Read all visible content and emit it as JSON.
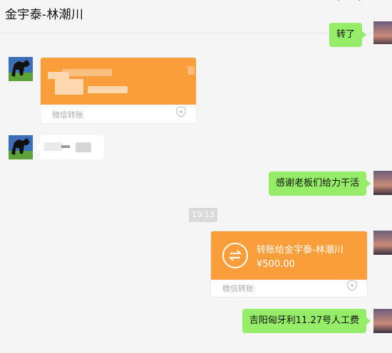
{
  "header": {
    "title": "金宇泰-林潮川"
  },
  "messages": {
    "top_partial_text": "转了",
    "left_transfer_footer": "微信转账",
    "thanks_text": "感谢老板们给力干活",
    "timestamp": "19:13",
    "transfer": {
      "recipient_text": "转账给金宇泰-林潮川",
      "amount_text": "¥500.00",
      "footer": "微信转账"
    },
    "wage_text": "吉阳匈牙利11.27号人工费"
  },
  "colors": {
    "green_bubble": "#95ec69",
    "transfer_orange": "#fa9d3b",
    "background": "#f5f5f5"
  },
  "icons": {
    "transfer_icon": "exchange-arrows-icon",
    "shield_icon": "shield-icon"
  }
}
